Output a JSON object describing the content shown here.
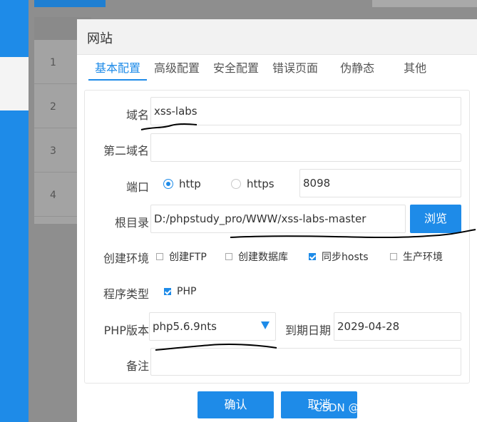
{
  "background": {
    "row_numbers": [
      "1",
      "2",
      "3",
      "4"
    ]
  },
  "dialog": {
    "title": "网站",
    "tabs": [
      {
        "label": "基本配置",
        "active": true
      },
      {
        "label": "高级配置",
        "active": false
      },
      {
        "label": "安全配置",
        "active": false
      },
      {
        "label": "错误页面",
        "active": false
      },
      {
        "label": "伪静态",
        "active": false
      },
      {
        "label": "其他",
        "active": false
      }
    ],
    "form": {
      "domain": {
        "label": "域名",
        "value": "xss-labs"
      },
      "second_domain": {
        "label": "第二域名",
        "value": ""
      },
      "port": {
        "label": "端口",
        "http_label": "http",
        "https_label": "https",
        "selected": "http",
        "value": "8098"
      },
      "root_dir": {
        "label": "根目录",
        "value": "D:/phpstudy_pro/WWW/xss-labs-master",
        "browse_label": "浏览"
      },
      "env": {
        "label": "创建环境",
        "options": [
          {
            "label": "创建FTP",
            "checked": false
          },
          {
            "label": "创建数据库",
            "checked": false
          },
          {
            "label": "同步hosts",
            "checked": true
          },
          {
            "label": "生产环境",
            "checked": false
          }
        ]
      },
      "program_type": {
        "label": "程序类型",
        "option": "PHP",
        "checked": true
      },
      "php_version": {
        "label": "PHP版本",
        "value": "php5.6.9nts"
      },
      "expiry": {
        "label": "到期日期",
        "value": "2029-04-28"
      },
      "remark": {
        "label": "备注",
        "value": ""
      }
    },
    "confirm_label": "确认",
    "cancel_label": "取消"
  },
  "watermark": "CSDN @键盘侠暴龙战神",
  "colors": {
    "accent": "#1e8be8",
    "overlay": "#8e8e8e"
  }
}
